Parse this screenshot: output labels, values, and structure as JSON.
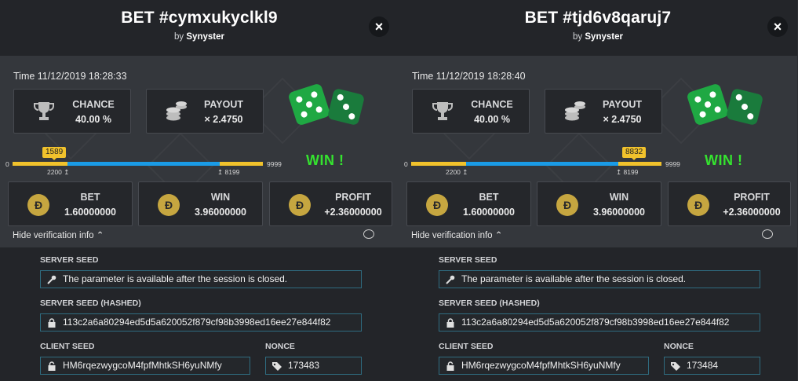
{
  "panels": [
    {
      "title": "BET #cymxukyclkl9",
      "by_label": "by",
      "by_user": "Synyster",
      "close_icon": "×",
      "time": "Time 11/12/2019 18:28:33",
      "chance_label": "CHANCE",
      "chance_value": "40.00 %",
      "payout_label": "PAYOUT",
      "payout_value": "× 2.4750",
      "roll_marker": "1589",
      "range_min": "0",
      "range_max": "9999",
      "low_tick": "2200",
      "high_tick": "8199",
      "result_text": "WIN !",
      "bet_label": "BET",
      "bet_value": "1.60000000",
      "win_label": "WIN",
      "win_value": "3.96000000",
      "profit_label": "PROFIT",
      "profit_value": "+2.36000000",
      "coin_symbol": "Đ",
      "hide_info": "Hide verification info",
      "server_seed_label": "SERVER SEED",
      "server_seed_value": "The parameter is available after the session is closed.",
      "server_seed_hashed_label": "SERVER SEED (HASHED)",
      "server_seed_hashed_value": "113c2a6a80294ed5d5a620052f879cf98b3998ed16ee27e844f82",
      "client_seed_label": "CLIENT SEED",
      "client_seed_value": "HM6rqezwygcoM4fpfMhtkSH6yuNMfy",
      "nonce_label": "NONCE",
      "nonce_value": "173483"
    },
    {
      "title": "BET #tjd6v8qaruj7",
      "by_label": "by",
      "by_user": "Synyster",
      "close_icon": "×",
      "time": "Time 11/12/2019 18:28:40",
      "chance_label": "CHANCE",
      "chance_value": "40.00 %",
      "payout_label": "PAYOUT",
      "payout_value": "× 2.4750",
      "roll_marker": "8832",
      "range_min": "0",
      "range_max": "9999",
      "low_tick": "2200",
      "high_tick": "8199",
      "result_text": "WIN !",
      "bet_label": "BET",
      "bet_value": "1.60000000",
      "win_label": "WIN",
      "win_value": "3.96000000",
      "profit_label": "PROFIT",
      "profit_value": "+2.36000000",
      "coin_symbol": "Đ",
      "hide_info": "Hide verification info",
      "server_seed_label": "SERVER SEED",
      "server_seed_value": "The parameter is available after the session is closed.",
      "server_seed_hashed_label": "SERVER SEED (HASHED)",
      "server_seed_hashed_value": "113c2a6a80294ed5d5a620052f879cf98b3998ed16ee27e844f82",
      "client_seed_label": "CLIENT SEED",
      "client_seed_value": "HM6rqezwygcoM4fpfMhtkSH6yuNMfy",
      "nonce_label": "NONCE",
      "nonce_value": "173484"
    }
  ],
  "colors": {
    "win_green": "#35e32f",
    "range_yellow": "#f1c22c",
    "range_blue": "#1a9be6",
    "coin_gold": "#c6a640",
    "dice_green": "#1fa843"
  },
  "icons": [
    "trophy-icon",
    "coins-icon",
    "dice-icon",
    "dogecoin-icon",
    "key-icon",
    "lock-icon",
    "unlock-icon",
    "tag-icon",
    "chat-icon",
    "close-icon"
  ]
}
